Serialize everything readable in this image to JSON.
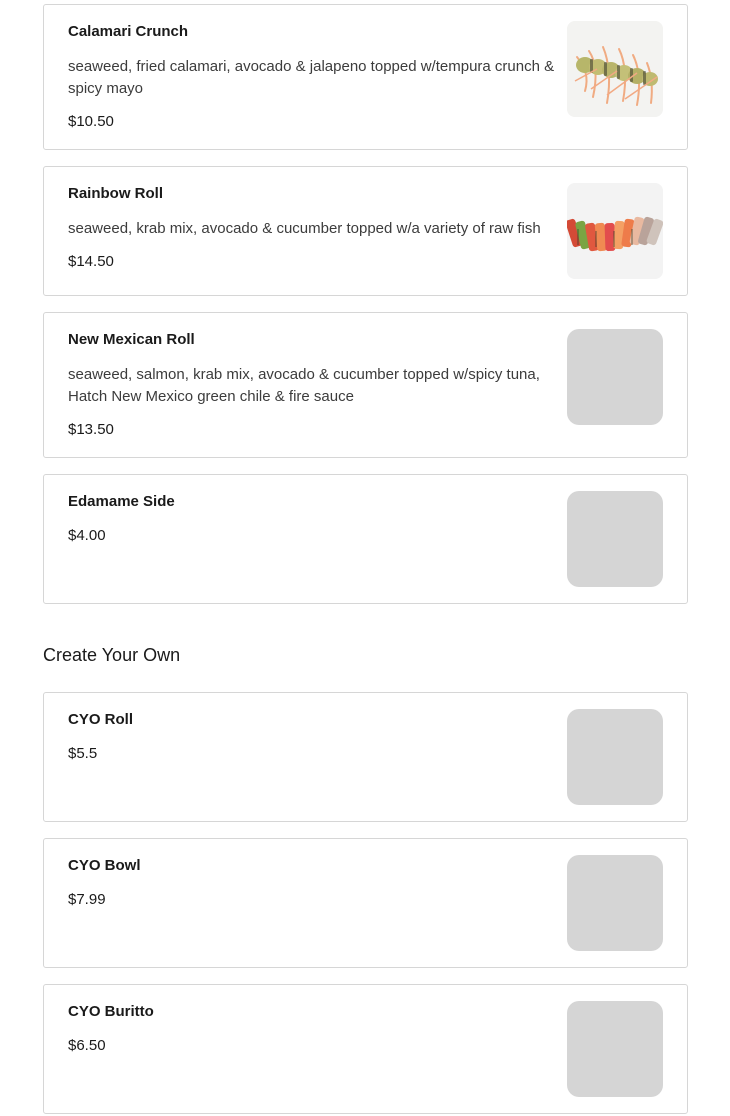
{
  "items": [
    {
      "name": "Calamari Crunch",
      "description": "seaweed, fried calamari, avocado & jalapeno topped w/tempura crunch & spicy mayo",
      "price": "$10.50",
      "image": "calamari-crunch-roll-photo"
    },
    {
      "name": "Rainbow Roll",
      "description": "seaweed, krab mix, avocado & cucumber topped w/a variety of raw fish",
      "price": "$14.50",
      "image": "rainbow-roll-photo"
    },
    {
      "name": "New Mexican Roll",
      "description": "seaweed, salmon, krab mix, avocado & cucumber topped w/spicy tuna, Hatch New Mexico green chile & fire sauce",
      "price": "$13.50",
      "image": "placeholder"
    },
    {
      "name": "Edamame Side",
      "price": "$4.00",
      "image": "placeholder"
    }
  ],
  "create_your_own": {
    "title": "Create Your Own",
    "items": [
      {
        "name": "CYO Roll",
        "price": "$5.5",
        "image": "placeholder"
      },
      {
        "name": "CYO Bowl",
        "price": "$7.99",
        "image": "placeholder"
      },
      {
        "name": "CYO Buritto",
        "price": "$6.50",
        "image": "placeholder"
      }
    ]
  },
  "colors": {
    "card_border": "#d6d6d6",
    "placeholder": "#d5d5d5",
    "text": "#1a1a1a"
  }
}
